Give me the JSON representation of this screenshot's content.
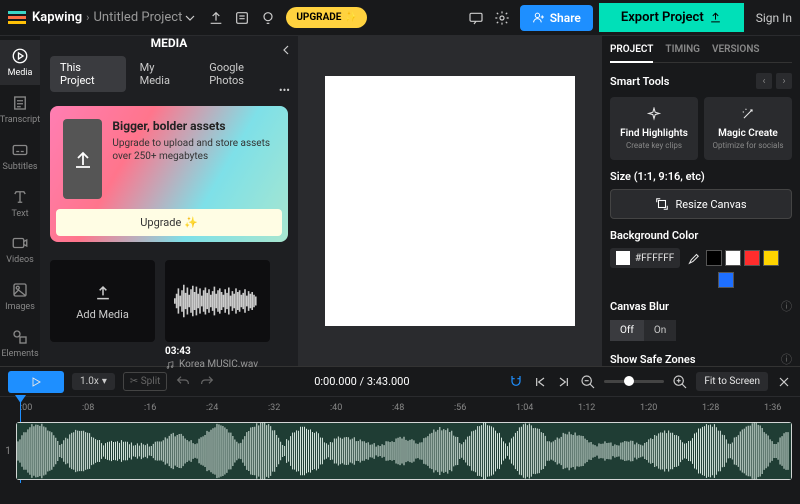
{
  "top": {
    "brand": "Kapwing",
    "crumb": "›",
    "project": "Untitled Project",
    "upgrade": "UPGRADE",
    "share": "Share",
    "export": "Export Project",
    "signin": "Sign In"
  },
  "rail": [
    {
      "label": "Media",
      "active": true
    },
    {
      "label": "Transcript"
    },
    {
      "label": "Subtitles"
    },
    {
      "label": "Text"
    },
    {
      "label": "Videos"
    },
    {
      "label": "Images"
    },
    {
      "label": "Elements"
    }
  ],
  "media": {
    "title": "MEDIA",
    "tabs": [
      {
        "label": "This Project",
        "active": true
      },
      {
        "label": "My Media"
      },
      {
        "label": "Google Photos"
      }
    ],
    "promo": {
      "title": "Bigger, bolder assets",
      "body": "Upgrade to upload and store assets over 250+ megabytes",
      "cta": "Upgrade ✨"
    },
    "add": "Add Media",
    "clip": {
      "dur": "03:43",
      "name": "Korea MUSIC.wav"
    }
  },
  "right": {
    "tabs": [
      {
        "label": "PROJECT",
        "active": true
      },
      {
        "label": "TIMING"
      },
      {
        "label": "VERSIONS"
      }
    ],
    "smart": {
      "title": "Smart Tools",
      "card1": {
        "t": "Find Highlights",
        "s": "Create key clips"
      },
      "card2": {
        "t": "Magic Create",
        "s": "Optimize for socials"
      }
    },
    "size": {
      "label": "Size (1:1, 9:16, etc)",
      "btn": "Resize Canvas"
    },
    "bg": {
      "label": "Background Color",
      "hex": "#FFFFFF"
    },
    "blur": {
      "label": "Canvas Blur",
      "off": "Off",
      "on": "On"
    },
    "safe": "Show Safe Zones"
  },
  "timeline": {
    "speed": "1.0x",
    "split": "✂ Split",
    "time": "0:00.000",
    "dur": "3:43.000",
    "fit": "Fit to Screen",
    "ticks": [
      ":00",
      ":08",
      ":16",
      ":24",
      ":32",
      ":40",
      ":48",
      ":56",
      "1:04",
      "1:12",
      "1:20",
      "1:28",
      "1:36"
    ],
    "track": "1"
  }
}
